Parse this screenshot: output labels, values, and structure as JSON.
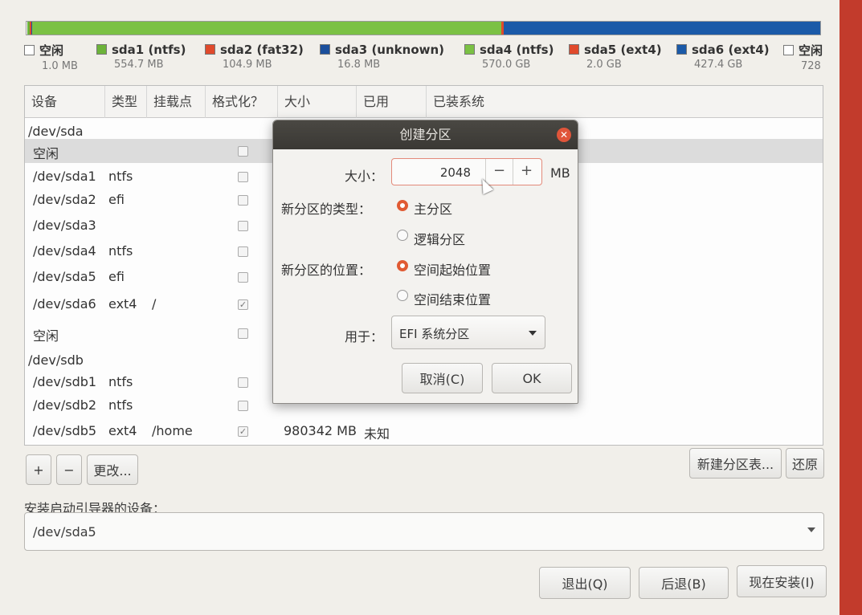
{
  "partition_bar": {
    "segments": [
      {
        "name": "free-start",
        "color": "#ffffff",
        "fraction": 0.001
      },
      {
        "name": "sda1",
        "color": "#6cb33a",
        "fraction": 0.003
      },
      {
        "name": "sda2",
        "color": "#e04a2c",
        "fraction": 0.002
      },
      {
        "name": "sda3",
        "color": "#1b4f9c",
        "fraction": 0.001
      },
      {
        "name": "sda4",
        "color": "#7bc144",
        "fraction": 0.591
      },
      {
        "name": "sda5",
        "color": "#e04a2c",
        "fraction": 0.003
      },
      {
        "name": "sda6",
        "color": "#1b5aa8",
        "fraction": 0.399
      }
    ]
  },
  "legend": [
    {
      "name": "空闲",
      "size": "1.0 MB",
      "color": "#ffffff"
    },
    {
      "name": "sda1 (ntfs)",
      "size": "554.7 MB",
      "color": "#6cb33a"
    },
    {
      "name": "sda2 (fat32)",
      "size": "104.9 MB",
      "color": "#e04a2c"
    },
    {
      "name": "sda3 (unknown)",
      "size": "16.8 MB",
      "color": "#1b4f9c"
    },
    {
      "name": "sda4 (ntfs)",
      "size": "570.0 GB",
      "color": "#7bc144"
    },
    {
      "name": "sda5 (ext4)",
      "size": "2.0 GB",
      "color": "#e04a2c"
    },
    {
      "name": "sda6 (ext4)",
      "size": "427.4 GB",
      "color": "#1b5aa8"
    },
    {
      "name": "空闲",
      "size": "728",
      "color": "#ffffff"
    }
  ],
  "table": {
    "headers": [
      "设备",
      "类型",
      "挂载点",
      "格式化？",
      "大小",
      "已用",
      "已装系统"
    ],
    "rows": [
      {
        "device": "/dev/sda",
        "type": "",
        "mount": "",
        "format": null,
        "size": "",
        "group": true
      },
      {
        "device": "空闲",
        "type": "",
        "mount": "",
        "format": false,
        "size": "",
        "selected": true
      },
      {
        "device": "/dev/sda1",
        "type": "ntfs",
        "mount": "",
        "format": false,
        "size": ""
      },
      {
        "device": "/dev/sda2",
        "type": "efi",
        "mount": "",
        "format": false,
        "size": ""
      },
      {
        "device": "/dev/sda3",
        "type": "",
        "mount": "",
        "format": false,
        "size": ""
      },
      {
        "device": "/dev/sda4",
        "type": "ntfs",
        "mount": "",
        "format": false,
        "size": ""
      },
      {
        "device": "/dev/sda5",
        "type": "efi",
        "mount": "",
        "format": false,
        "size": ""
      },
      {
        "device": "/dev/sda6",
        "type": "ext4",
        "mount": "/",
        "format": true,
        "size": ""
      },
      {
        "device": "空闲",
        "type": "",
        "mount": "",
        "format": false,
        "size": ""
      },
      {
        "device": "/dev/sdb",
        "type": "",
        "mount": "",
        "format": null,
        "size": "",
        "group": true
      },
      {
        "device": "/dev/sdb1",
        "type": "ntfs",
        "mount": "",
        "format": false,
        "size": ""
      },
      {
        "device": "/dev/sdb2",
        "type": "ntfs",
        "mount": "",
        "format": false,
        "size": ""
      },
      {
        "device": "/dev/sdb5",
        "type": "ext4",
        "mount": "/home",
        "format": true,
        "size": "980342 MB",
        "used": "未知"
      }
    ]
  },
  "toolbar": {
    "add_label": "+",
    "remove_label": "−",
    "change_label": "更改...",
    "new_table_label": "新建分区表...",
    "revert_label": "还原"
  },
  "bootloader": {
    "label": "安装启动引导器的设备：",
    "value": "/dev/sda5"
  },
  "footer": {
    "quit_label": "退出(Q)",
    "back_label": "后退(B)",
    "install_label": "现在安装(I)"
  },
  "dialog": {
    "title": "创建分区",
    "size_label": "大小：",
    "size_value": "2048",
    "size_unit": "MB",
    "type_label": "新分区的类型：",
    "type_primary": "主分区",
    "type_logical": "逻辑分区",
    "location_label": "新分区的位置：",
    "location_start": "空间起始位置",
    "location_end": "空间结束位置",
    "use_label": "用于：",
    "use_value": "EFI 系统分区",
    "cancel_label": "取消(C)",
    "ok_label": "OK"
  }
}
